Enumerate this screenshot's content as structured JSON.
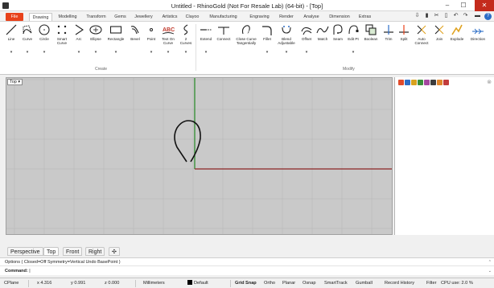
{
  "window": {
    "title": "Untitled - RhinoGold (Not For Resale Lab) (64-bit) - [Top]",
    "controls": [
      "–",
      "☐",
      "✕"
    ]
  },
  "ribbon_tabs": [
    "File",
    "Drawing",
    "Modelling",
    "Transform",
    "Gems",
    "Jewellery",
    "Artistics",
    "Clayoo",
    "Manufacturing",
    "Engraving",
    "Render",
    "Analyse",
    "Dimension",
    "Extras"
  ],
  "quick_access": [
    "⇩",
    "▮",
    "✂",
    "▯",
    "↶",
    "↷",
    "▬",
    "?"
  ],
  "create_group": {
    "label": "Create",
    "tools": [
      "Line",
      "Curve",
      "Circle",
      "Smart\nCurve",
      "Arc",
      "Ellipse",
      "Rectangle",
      "Bevel",
      "Point",
      "Text On\nCurve",
      "2\nCurves"
    ]
  },
  "modify_group": {
    "label": "Modify",
    "tools": [
      "Extend",
      "Connect",
      "Close Curve\nTangentially",
      "Fillet",
      "Blend\nAdjustable",
      "Offset",
      "Match",
      "Seam",
      "Edit Pt",
      "Boolean",
      "Trim",
      "Split",
      "Auto\nConnect",
      "Join",
      "Explode",
      "Direction"
    ]
  },
  "viewport": {
    "label": "Top",
    "menu_arrow": "▾",
    "grid": true,
    "colors": {
      "background": "#c9c9c9",
      "grid": "#b7b7b7",
      "x_axis": "#8b2525",
      "y_axis": "#2f8c2f",
      "curve": "#111111"
    }
  },
  "side_panel": {
    "close": "⊗",
    "tab_colors": [
      "#e04b2b",
      "#2d6ec7",
      "#d8a21f",
      "#3a8f3a",
      "#a547a0",
      "#3d3d3d",
      "#e0862b",
      "#c23c3c"
    ]
  },
  "viewport_tabs": [
    "Perspective",
    "Top",
    "Front",
    "Right",
    "✣"
  ],
  "command": {
    "history": "Options ( Closed=Off  Symmetry=Vertical  Undo  BasePoint )",
    "prompt_label": "Command:",
    "prompt_value": ""
  },
  "statusbar": {
    "cplane": "CPlane",
    "x": "x 4.316",
    "y": "y 0.991",
    "z": "z 0.000",
    "units": "Millimeters",
    "layer": "Default",
    "toggles": [
      "Grid Snap",
      "Ortho",
      "Planar",
      "Osnap",
      "SmartTrack",
      "Gumball",
      "Record History",
      "Filter"
    ],
    "cpu": "CPU use: 2.0 %"
  }
}
